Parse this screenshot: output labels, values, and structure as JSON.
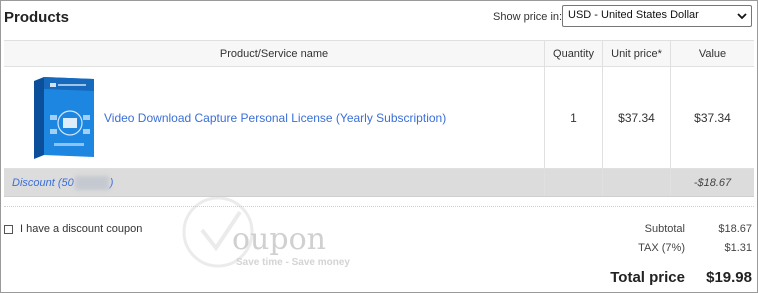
{
  "header": {
    "title": "Products",
    "currency_label": "Show price in:",
    "currency_selected": "USD - United States Dollar"
  },
  "table": {
    "columns": [
      "Product/Service name",
      "Quantity",
      "Unit price*",
      "Value"
    ],
    "item": {
      "name": "Video Download Capture Personal License (Yearly Subscription)",
      "quantity": "1",
      "unit_price": "$37.34",
      "value": "$37.34"
    },
    "discount": {
      "label_start": "Discount (50",
      "label_end": ")",
      "value": "-$18.67"
    }
  },
  "coupon": {
    "label": "I have a discount coupon"
  },
  "totals": {
    "subtotal_label": "Subtotal",
    "subtotal_value": "$18.67",
    "tax_label": "TAX (7%)",
    "tax_value": "$1.31",
    "total_label": "Total price",
    "total_value": "$19.98"
  },
  "watermark": {
    "word": "oupon",
    "tagline": "Save time - Save money"
  },
  "colors": {
    "link": "#3a6fd8",
    "discount_row": "#dcdcdc",
    "header_row": "#f7f7f7"
  }
}
